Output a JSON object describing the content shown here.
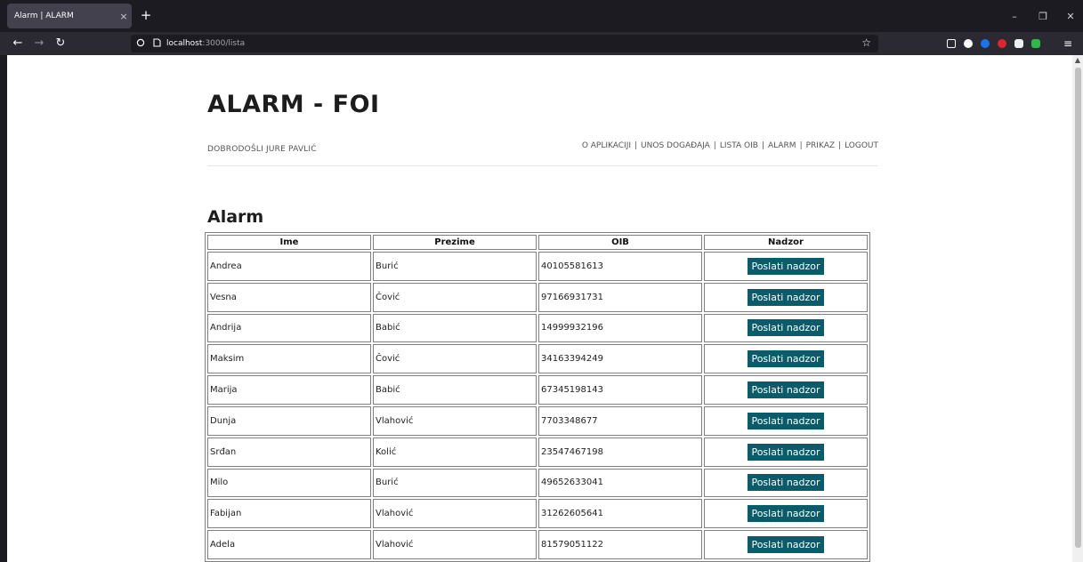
{
  "browser": {
    "tab_title": "Alarm | ALARM",
    "tab_close": "×",
    "new_tab": "+",
    "url_host": "localhost",
    "url_path": ":3000/lista",
    "window_controls": {
      "minimize": "–",
      "restore": "❐",
      "close": "✕"
    },
    "nav": {
      "back": "←",
      "forward": "→",
      "reload": "↻"
    },
    "bookmark_star": "☆"
  },
  "header": {
    "site_title": "ALARM - FOI",
    "welcome": "DOBRODOŠLI JURE PAVLIĆ",
    "nav": [
      {
        "label": "O APLIKACIJI"
      },
      {
        "label": "UNOS DOGAĐAJA"
      },
      {
        "label": "LISTA OIB"
      },
      {
        "label": "ALARM"
      },
      {
        "label": "PRIKAZ"
      },
      {
        "label": "LOGOUT"
      }
    ]
  },
  "main": {
    "title": "Alarm",
    "columns": [
      "Ime",
      "Prezime",
      "OIB",
      "Nadzor"
    ],
    "button_label": "Poslati nadzor",
    "rows": [
      {
        "ime": "Andrea",
        "prezime": "Burić",
        "oib": "40105581613"
      },
      {
        "ime": "Vesna",
        "prezime": "Čović",
        "oib": "97166931731"
      },
      {
        "ime": "Andrija",
        "prezime": "Babić",
        "oib": "14999932196"
      },
      {
        "ime": "Maksim",
        "prezime": "Čović",
        "oib": "34163394249"
      },
      {
        "ime": "Marija",
        "prezime": "Babić",
        "oib": "67345198143"
      },
      {
        "ime": "Dunja",
        "prezime": "Vlahović",
        "oib": "7703348677"
      },
      {
        "ime": "Srđan",
        "prezime": "Kolić",
        "oib": "23547467198"
      },
      {
        "ime": "Milo",
        "prezime": "Burić",
        "oib": "49652633041"
      },
      {
        "ime": "Fabijan",
        "prezime": "Vlahović",
        "oib": "31262605641"
      },
      {
        "ime": "Adela",
        "prezime": "Vlahović",
        "oib": "81579051122"
      }
    ]
  },
  "colors": {
    "button": "#0a5c6b",
    "browser_chrome": "#1c1b22",
    "toolbar": "#2b2a33"
  }
}
